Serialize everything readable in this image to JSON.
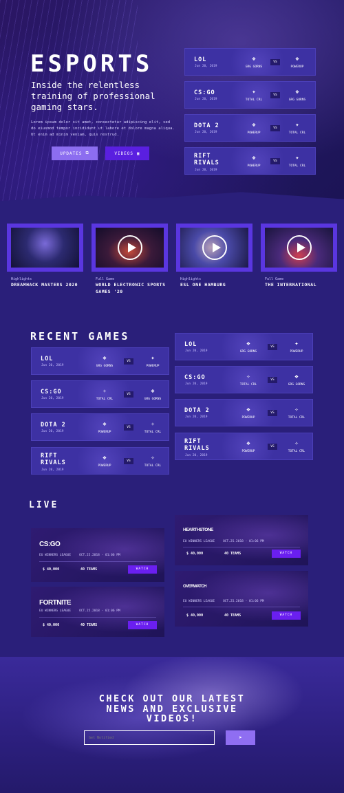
{
  "hero": {
    "title": "ESPORTS",
    "subtitle": "Inside the relentless training of professional gaming stars.",
    "body": "Lorem ipsum dolor sit amet, consectetur adipiscing elit, sed do eiusmod tempor incididunt ut labore et dolore magna aliqua. Ut enim ad minim veniam, quis nostrud.",
    "updates_label": "UPDATES",
    "videos_label": "VIDEOS",
    "matches": [
      {
        "game": "LOL",
        "date": "Jun 20, 2019",
        "team1": "GRG GORNS",
        "team2": "POWERUP",
        "vs": "VS"
      },
      {
        "game": "CS:GO",
        "date": "Jun 20, 2019",
        "team1": "TOTAL CRL",
        "team2": "GRG GORNS",
        "vs": "VS"
      },
      {
        "game": "DOTA 2",
        "date": "Jun 20, 2019",
        "team1": "POWERUP",
        "team2": "TOTAL CRL",
        "vs": "VS"
      },
      {
        "game": "RIFT RIVALS",
        "date": "Jun 20, 2019",
        "team1": "POWERUP",
        "team2": "TOTAL CRL",
        "vs": "VS"
      }
    ]
  },
  "featured": [
    {
      "category": "Highlights",
      "title": "DREAMHACK MASTERS 2020",
      "play": false
    },
    {
      "category": "Full Game",
      "title": "WORLD ELECTRONIC SPORTS GAMES '20",
      "play": true
    },
    {
      "category": "Highlights",
      "title": "ESL ONE HAMBURG",
      "play": true
    },
    {
      "category": "Full Game",
      "title": "THE INTERNATIONAL",
      "play": true
    }
  ],
  "recent": {
    "heading": "RECENT GAMES",
    "matches": [
      {
        "game": "LOL",
        "date": "Jun 20, 2019",
        "team1": "GRG GORNS",
        "team2": "POWERUP",
        "vs": "VS"
      },
      {
        "game": "LOL",
        "date": "Jun 20, 2019",
        "team1": "GRG GORNS",
        "team2": "POWERUP",
        "vs": "VS"
      },
      {
        "game": "CS:GO",
        "date": "Jun 20, 2019",
        "team1": "TOTAL CRL",
        "team2": "GRG GORNS",
        "vs": "VS"
      },
      {
        "game": "CS:GO",
        "date": "Jun 20, 2019",
        "team1": "TOTAL CRL",
        "team2": "GRG GORNS",
        "vs": "VS"
      },
      {
        "game": "DOTA 2",
        "date": "Jun 20, 2019",
        "team1": "POWERUP",
        "team2": "TOTAL CRL",
        "vs": "VS"
      },
      {
        "game": "DOTA 2",
        "date": "Jun 20, 2019",
        "team1": "POWERUP",
        "team2": "TOTAL CRL",
        "vs": "VS"
      },
      {
        "game": "RIFT RIVALS",
        "date": "Jun 20, 2019",
        "team1": "POWERUP",
        "team2": "TOTAL CRL",
        "vs": "VS"
      },
      {
        "game": "RIFT RIVALS",
        "date": "Jun 20, 2019",
        "team1": "POWERUP",
        "team2": "TOTAL CRL",
        "vs": "VS"
      }
    ]
  },
  "live": {
    "heading": "LIVE",
    "events": [
      {
        "logo": "CS:GO",
        "league": "EU WINNERS LEAGUE",
        "datetime": "OCT.25.2018 - 01:06 PM",
        "prize": "$ 40,000",
        "teams": "40 TEAMS",
        "watch": "WATCH"
      },
      {
        "logo": "HEARTHSTONE",
        "league": "EU WINNERS LEAGUE",
        "datetime": "OCT.25.2018 - 01:06 PM",
        "prize": "$ 40,000",
        "teams": "40 TEAMS",
        "watch": "WATCH"
      },
      {
        "logo": "FORTNITE",
        "league": "EU WINNERS LEAGUE",
        "datetime": "OCT.25.2018 - 01:06 PM",
        "prize": "$ 40,000",
        "teams": "40 TEAMS",
        "watch": "WATCH"
      },
      {
        "logo": "OVERWATCH",
        "league": "EU WINNERS LEAGUE",
        "datetime": "OCT.25.2018 - 01:06 PM",
        "prize": "$ 40,000",
        "teams": "40 TEAMS",
        "watch": "WATCH"
      }
    ]
  },
  "cta": {
    "title_line1": "CHECK OUT OUR LATEST",
    "title_line2": "NEWS AND EXCLUSIVE",
    "title_line3": "VIDEOS!",
    "input_placeholder": "Get Notified",
    "submit_icon": "send-icon"
  },
  "colors": {
    "bg": "#2a1f7a",
    "card": "#3d31a3",
    "accent": "#8c6df0",
    "button": "#5a1fe0",
    "watch": "#6a1ff0"
  }
}
